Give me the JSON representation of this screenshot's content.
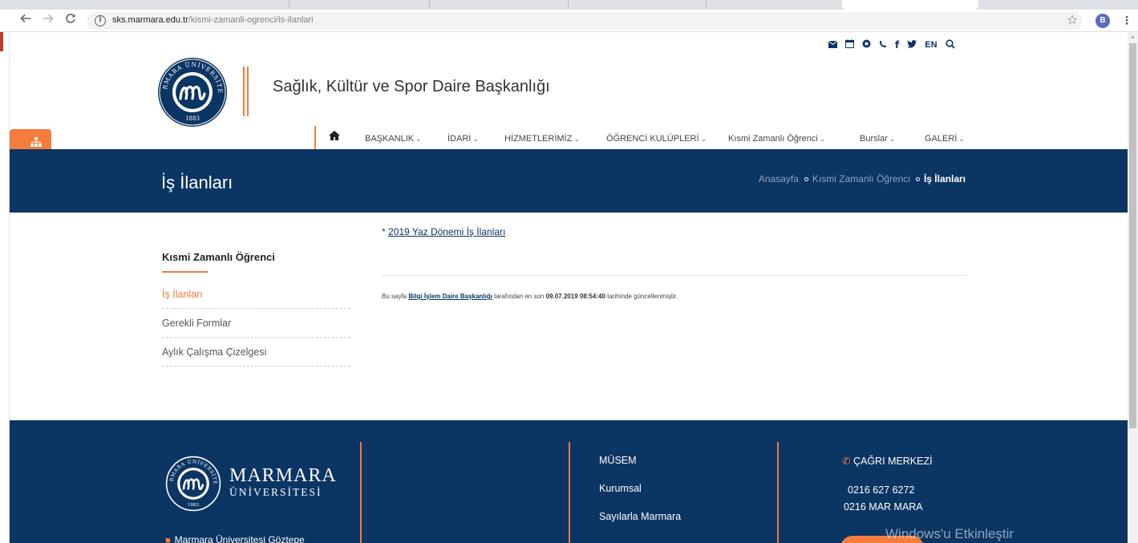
{
  "browser": {
    "url_host": "sks.marmara.edu.tr",
    "url_path": "/kismi-zamanli-ogrenci/is-ilanlari",
    "profile_initial": "B",
    "back_icon": "arrow-left-icon",
    "forward_icon": "arrow-right-icon",
    "reload_icon": "reload-icon"
  },
  "header": {
    "site_title": "Sağlık, Kültür ve Spor Daire Başkanlığı",
    "top_icons": [
      "envelope-icon",
      "calendar-icon",
      "globe-icon",
      "phone-icon",
      "facebook-icon",
      "twitter-icon"
    ],
    "language": "EN",
    "seal": {
      "arc_text": "MARMARA ÜNİVERSİTESİ",
      "year": "1883"
    }
  },
  "nav": {
    "items": [
      {
        "label": "BAŞKANLIK"
      },
      {
        "label": "İDARİ"
      },
      {
        "label": "HİZMETLERİMİZ"
      },
      {
        "label": "ÖĞRENCİ KULÜPLERİ"
      },
      {
        "label": "Kısmi Zamanlı Öğrenci"
      },
      {
        "label": "Burslar"
      },
      {
        "label": "GALERİ"
      }
    ]
  },
  "banner": {
    "page_title": "İş İlanları",
    "breadcrumb": {
      "home": "Anasayfa",
      "parent": "Kısmi Zamanlı Öğrenci",
      "current": "İş İlanları"
    }
  },
  "sidebar": {
    "heading": "Kısmi Zamanlı Öğrenci",
    "items": [
      {
        "label": "İş İlanları",
        "active": true
      },
      {
        "label": "Gerekli Formlar",
        "active": false
      },
      {
        "label": "Aylık Çalışma Çizelgesi",
        "active": false
      }
    ]
  },
  "content": {
    "bullet": "*",
    "link": "2019 Yaz Dönemi İş İlanları",
    "updated_prefix": "Bu sayfa",
    "updated_author": "Bilgi İşlem Daire Başkanlığı",
    "updated_middle": "tarafından en son",
    "updated_date": "09.07.2019 08:54:40",
    "updated_suffix": "tarihinde güncellenmiştir."
  },
  "footer": {
    "brand_line1": "MARMARA",
    "brand_line2": "ÜNİVERSİTESİ",
    "address": "Marmara Üniversitesi Göztepe",
    "links": [
      "MÜSEM",
      "Kurumsal",
      "Sayılarla Marmara"
    ],
    "call_center_label": "ÇAĞRI MERKEZİ",
    "phone_numbers": [
      "0216 627 6272",
      "0216 MAR MARA"
    ]
  },
  "os_watermark": "Windows'u Etkinleştir",
  "colors": {
    "navy": "#0b3563",
    "accent_orange": "#f47c3c"
  }
}
